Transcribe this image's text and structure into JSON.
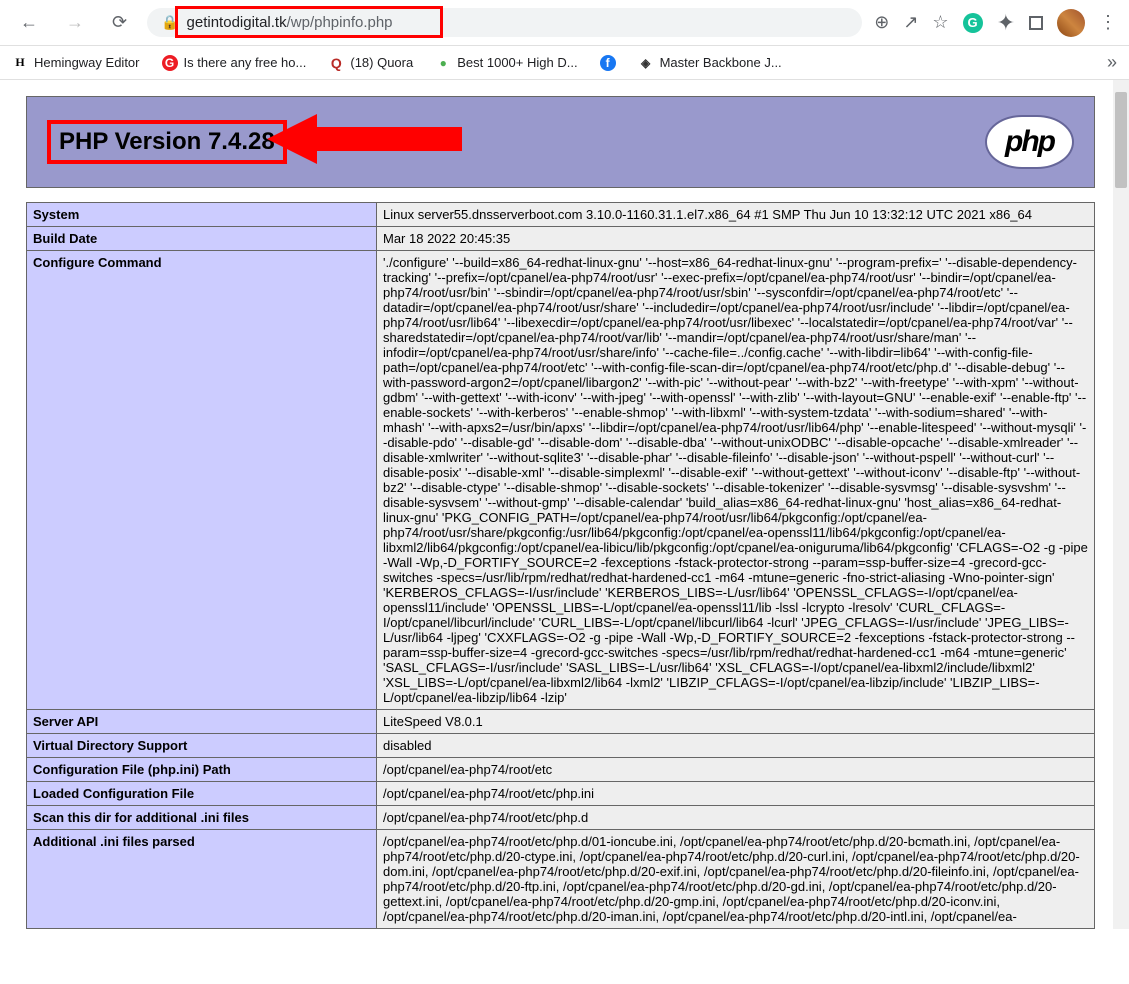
{
  "browser": {
    "url_host": "getintodigital.tk",
    "url_path": "/wp/phpinfo.php"
  },
  "bookmarks": [
    {
      "icon": "H",
      "label": "Hemingway Editor",
      "cls": "bm-h"
    },
    {
      "icon": "G",
      "label": "Is there any free ho...",
      "cls": "bm-g"
    },
    {
      "icon": "Q",
      "label": "(18) Quora",
      "cls": "bm-q"
    },
    {
      "icon": "●",
      "label": "Best 1000+ High D...",
      "cls": "bm-globe"
    },
    {
      "icon": "f",
      "label": "",
      "cls": "bm-fb"
    },
    {
      "icon": "◈",
      "label": "Master Backbone J...",
      "cls": "bm-diamond"
    }
  ],
  "php": {
    "title": "PHP Version 7.4.28",
    "logo_text": "php"
  },
  "rows": [
    {
      "k": "System",
      "v": "Linux server55.dnsserverboot.com 3.10.0-1160.31.1.el7.x86_64 #1 SMP Thu Jun 10 13:32:12 UTC 2021 x86_64"
    },
    {
      "k": "Build Date",
      "v": "Mar 18 2022 20:45:35"
    },
    {
      "k": "Configure Command",
      "v": "'./configure' '--build=x86_64-redhat-linux-gnu' '--host=x86_64-redhat-linux-gnu' '--program-prefix=' '--disable-dependency-tracking' '--prefix=/opt/cpanel/ea-php74/root/usr' '--exec-prefix=/opt/cpanel/ea-php74/root/usr' '--bindir=/opt/cpanel/ea-php74/root/usr/bin' '--sbindir=/opt/cpanel/ea-php74/root/usr/sbin' '--sysconfdir=/opt/cpanel/ea-php74/root/etc' '--datadir=/opt/cpanel/ea-php74/root/usr/share' '--includedir=/opt/cpanel/ea-php74/root/usr/include' '--libdir=/opt/cpanel/ea-php74/root/usr/lib64' '--libexecdir=/opt/cpanel/ea-php74/root/usr/libexec' '--localstatedir=/opt/cpanel/ea-php74/root/var' '--sharedstatedir=/opt/cpanel/ea-php74/root/var/lib' '--mandir=/opt/cpanel/ea-php74/root/usr/share/man' '--infodir=/opt/cpanel/ea-php74/root/usr/share/info' '--cache-file=../config.cache' '--with-libdir=lib64' '--with-config-file-path=/opt/cpanel/ea-php74/root/etc' '--with-config-file-scan-dir=/opt/cpanel/ea-php74/root/etc/php.d' '--disable-debug' '--with-password-argon2=/opt/cpanel/libargon2' '--with-pic' '--without-pear' '--with-bz2' '--with-freetype' '--with-xpm' '--without-gdbm' '--with-gettext' '--with-iconv' '--with-jpeg' '--with-openssl' '--with-zlib' '--with-layout=GNU' '--enable-exif' '--enable-ftp' '--enable-sockets' '--with-kerberos' '--enable-shmop' '--with-libxml' '--with-system-tzdata' '--with-sodium=shared' '--with-mhash' '--with-apxs2=/usr/bin/apxs' '--libdir=/opt/cpanel/ea-php74/root/usr/lib64/php' '--enable-litespeed' '--without-mysqli' '--disable-pdo' '--disable-gd' '--disable-dom' '--disable-dba' '--without-unixODBC' '--disable-opcache' '--disable-xmlreader' '--disable-xmlwriter' '--without-sqlite3' '--disable-phar' '--disable-fileinfo' '--disable-json' '--without-pspell' '--without-curl' '--disable-posix' '--disable-xml' '--disable-simplexml' '--disable-exif' '--without-gettext' '--without-iconv' '--disable-ftp' '--without-bz2' '--disable-ctype' '--disable-shmop' '--disable-sockets' '--disable-tokenizer' '--disable-sysvmsg' '--disable-sysvshm' '--disable-sysvsem' '--without-gmp' '--disable-calendar' 'build_alias=x86_64-redhat-linux-gnu' 'host_alias=x86_64-redhat-linux-gnu' 'PKG_CONFIG_PATH=/opt/cpanel/ea-php74/root/usr/lib64/pkgconfig:/opt/cpanel/ea-php74/root/usr/share/pkgconfig:/usr/lib64/pkgconfig:/opt/cpanel/ea-openssl11/lib64/pkgconfig:/opt/cpanel/ea-libxml2/lib64/pkgconfig:/opt/cpanel/ea-libicu/lib/pkgconfig:/opt/cpanel/ea-oniguruma/lib64/pkgconfig' 'CFLAGS=-O2 -g -pipe -Wall -Wp,-D_FORTIFY_SOURCE=2 -fexceptions -fstack-protector-strong --param=ssp-buffer-size=4 -grecord-gcc-switches -specs=/usr/lib/rpm/redhat/redhat-hardened-cc1 -m64 -mtune=generic -fno-strict-aliasing -Wno-pointer-sign' 'KERBEROS_CFLAGS=-I/usr/include' 'KERBEROS_LIBS=-L/usr/lib64' 'OPENSSL_CFLAGS=-I/opt/cpanel/ea-openssl11/include' 'OPENSSL_LIBS=-L/opt/cpanel/ea-openssl11/lib -lssl -lcrypto -lresolv' 'CURL_CFLAGS=-I/opt/cpanel/libcurl/include' 'CURL_LIBS=-L/opt/cpanel/libcurl/lib64 -lcurl' 'JPEG_CFLAGS=-I/usr/include' 'JPEG_LIBS=-L/usr/lib64 -ljpeg' 'CXXFLAGS=-O2 -g -pipe -Wall -Wp,-D_FORTIFY_SOURCE=2 -fexceptions -fstack-protector-strong --param=ssp-buffer-size=4 -grecord-gcc-switches -specs=/usr/lib/rpm/redhat/redhat-hardened-cc1 -m64 -mtune=generic' 'SASL_CFLAGS=-I/usr/include' 'SASL_LIBS=-L/usr/lib64' 'XSL_CFLAGS=-I/opt/cpanel/ea-libxml2/include/libxml2' 'XSL_LIBS=-L/opt/cpanel/ea-libxml2/lib64 -lxml2' 'LIBZIP_CFLAGS=-I/opt/cpanel/ea-libzip/include' 'LIBZIP_LIBS=-L/opt/cpanel/ea-libzip/lib64 -lzip'"
    },
    {
      "k": "Server API",
      "v": "LiteSpeed V8.0.1"
    },
    {
      "k": "Virtual Directory Support",
      "v": "disabled"
    },
    {
      "k": "Configuration File (php.ini) Path",
      "v": "/opt/cpanel/ea-php74/root/etc"
    },
    {
      "k": "Loaded Configuration File",
      "v": "/opt/cpanel/ea-php74/root/etc/php.ini"
    },
    {
      "k": "Scan this dir for additional .ini files",
      "v": "/opt/cpanel/ea-php74/root/etc/php.d"
    },
    {
      "k": "Additional .ini files parsed",
      "v": "/opt/cpanel/ea-php74/root/etc/php.d/01-ioncube.ini, /opt/cpanel/ea-php74/root/etc/php.d/20-bcmath.ini, /opt/cpanel/ea-php74/root/etc/php.d/20-ctype.ini, /opt/cpanel/ea-php74/root/etc/php.d/20-curl.ini, /opt/cpanel/ea-php74/root/etc/php.d/20-dom.ini, /opt/cpanel/ea-php74/root/etc/php.d/20-exif.ini, /opt/cpanel/ea-php74/root/etc/php.d/20-fileinfo.ini, /opt/cpanel/ea-php74/root/etc/php.d/20-ftp.ini, /opt/cpanel/ea-php74/root/etc/php.d/20-gd.ini, /opt/cpanel/ea-php74/root/etc/php.d/20-gettext.ini, /opt/cpanel/ea-php74/root/etc/php.d/20-gmp.ini, /opt/cpanel/ea-php74/root/etc/php.d/20-iconv.ini, /opt/cpanel/ea-php74/root/etc/php.d/20-iman.ini, /opt/cpanel/ea-php74/root/etc/php.d/20-intl.ini, /opt/cpanel/ea-"
    }
  ]
}
